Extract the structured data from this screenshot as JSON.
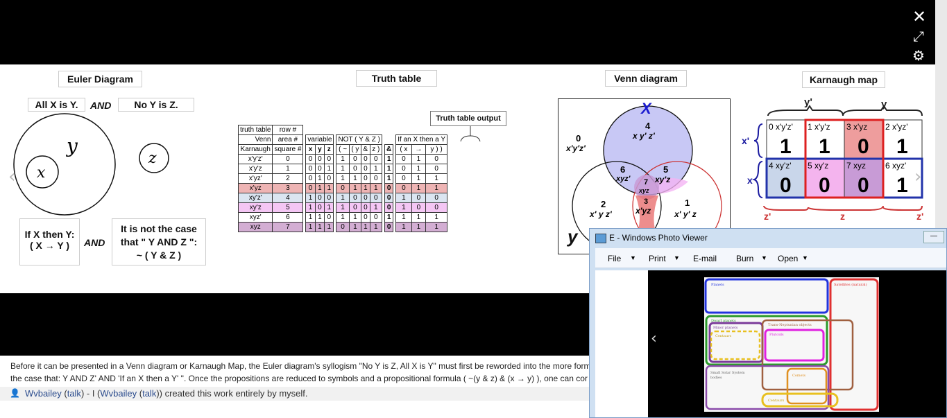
{
  "viewer": {
    "close_icon": "close-icon",
    "expand_icon": "expand-icon",
    "settings_icon": "gear-icon",
    "prev_glyph": "‹",
    "next_glyph": "›"
  },
  "figure": {
    "euler": {
      "title": "Euler Diagram",
      "premise1": "All X is Y.",
      "and": "AND",
      "premise2": "No Y is Z.",
      "y_label": "y",
      "x_label": "x",
      "z_label": "z",
      "ifthen_line1": "If X then Y:",
      "ifthen_line2": "( X → Y )",
      "and2": "AND",
      "notcase_line1": "It is not the case",
      "notcase_line2": "that \" Y AND Z \":",
      "notcase_line3": "~ ( Y & Z )"
    },
    "truth": {
      "title": "Truth table",
      "output_label": "Truth table output",
      "hdr_truthtable": "truth table",
      "hdr_row": "row #",
      "hdr_venn": "Venn",
      "hdr_area": "area #",
      "hdr_karnaugh": "Karnaugh",
      "hdr_square": "square #",
      "hdr_variable": "variable",
      "hdr_not": "NOT ( Y & Z )",
      "hdr_ifthen": "If an X then a Y",
      "cols": [
        "x",
        "y",
        "z",
        "( ~",
        "( y",
        "&",
        "z )",
        "&",
        "( x",
        "→",
        "y ) )"
      ],
      "rows": [
        {
          "term": "x'y'z'",
          "n": "0",
          "v": [
            "0",
            "0",
            "0"
          ],
          "o": [
            "1",
            "0",
            "0",
            "0",
            "1",
            "0",
            "1",
            "0"
          ],
          "bg": "#ffffff"
        },
        {
          "term": "x'y'z",
          "n": "1",
          "v": [
            "0",
            "0",
            "1"
          ],
          "o": [
            "1",
            "0",
            "0",
            "1",
            "1",
            "0",
            "1",
            "0"
          ],
          "bg": "#ffffff"
        },
        {
          "term": "x'yz'",
          "n": "2",
          "v": [
            "0",
            "1",
            "0"
          ],
          "o": [
            "1",
            "1",
            "0",
            "0",
            "1",
            "0",
            "1",
            "1"
          ],
          "bg": "#ffffff"
        },
        {
          "term": "x'yz",
          "n": "3",
          "v": [
            "0",
            "1",
            "1"
          ],
          "o": [
            "0",
            "1",
            "1",
            "1",
            "0",
            "0",
            "1",
            "1"
          ],
          "bg": "#eeb4b4"
        },
        {
          "term": "xy'z'",
          "n": "4",
          "v": [
            "1",
            "0",
            "0"
          ],
          "o": [
            "1",
            "0",
            "0",
            "0",
            "0",
            "1",
            "0",
            "0"
          ],
          "bg": "#dbe5f1"
        },
        {
          "term": "xy'z",
          "n": "5",
          "v": [
            "1",
            "0",
            "1"
          ],
          "o": [
            "1",
            "0",
            "0",
            "1",
            "0",
            "1",
            "0",
            "0"
          ],
          "bg": "#f4c6f4"
        },
        {
          "term": "xyz'",
          "n": "6",
          "v": [
            "1",
            "1",
            "0"
          ],
          "o": [
            "1",
            "1",
            "0",
            "0",
            "1",
            "1",
            "1",
            "1"
          ],
          "bg": "#ffffff"
        },
        {
          "term": "xyz",
          "n": "7",
          "v": [
            "1",
            "1",
            "1"
          ],
          "o": [
            "0",
            "1",
            "1",
            "1",
            "0",
            "1",
            "1",
            "1"
          ],
          "bg": "#d3aed3"
        }
      ]
    },
    "venn": {
      "title": "Venn diagram",
      "x": "X",
      "y": "y",
      "a0n": "0",
      "a0": "x'y'z'",
      "a4n": "4",
      "a4": "x y' z'",
      "a6n": "6",
      "a6": "xyz'",
      "a5n": "5",
      "a5": "xy'z",
      "a7n": "7",
      "a7": "xyz",
      "a2n": "2",
      "a2": "x' y z'",
      "a3n": "3",
      "a3": "x'yz",
      "a1n": "1",
      "a1": "x' y' z"
    },
    "kmap": {
      "title": "Karnaugh map",
      "yp": "y'",
      "y": "y",
      "xp": "x'",
      "x": "x",
      "zp1": "z'",
      "z": "z",
      "zp2": "z'",
      "cells": [
        {
          "n": "0",
          "t": "x'y'z'",
          "v": "1",
          "bg": "#ffffff"
        },
        {
          "n": "1",
          "t": "x'y'z",
          "v": "1",
          "bg": "#ffffff"
        },
        {
          "n": "3",
          "t": "x'yz",
          "v": "0",
          "bg": "#ee9d9d"
        },
        {
          "n": "2",
          "t": "x'yz'",
          "v": "1",
          "bg": "#ffffff"
        },
        {
          "n": "4",
          "t": "xy'z'",
          "v": "0",
          "bg": "#c9d6ea"
        },
        {
          "n": "5",
          "t": "xy'z",
          "v": "0",
          "bg": "#f4b4ee"
        },
        {
          "n": "7",
          "t": "xyz",
          "v": "0",
          "bg": "#c89bd6"
        },
        {
          "n": "6",
          "t": "xyz'",
          "v": "1",
          "bg": "#ffffff"
        }
      ]
    }
  },
  "caption": {
    "line1": "Before it can be presented in a Venn diagram or Karnaugh Map, the Euler diagram's syllogism \"No Y is Z, All X is Y\" must first be reworded into the more form",
    "line2": "the case that: Y AND Z' AND 'If an X then a Y' \". Once the propositions are reduced to symbols and a propositional formula ( ~(y & z) & (x → y) ), one can cor",
    "author": "Wvbailey",
    "talk1": "talk",
    "mid": " - I (",
    "author2": "Wvbailey",
    "talk2": "talk",
    "tail": ")) created this work entirely by myself."
  },
  "photo_viewer": {
    "title": "E - Windows Photo Viewer",
    "menu": [
      "File",
      "Print",
      "E-mail",
      "Burn",
      "Open"
    ],
    "img": {
      "planets": "Planets",
      "satellites": "Satellites (natural)",
      "dwarf": "Dwarf planets",
      "minor": "Minor planets",
      "tno": "Trans-Neptunian objects",
      "centaurs": "Centaurs",
      "plutoids": "Plutoids",
      "sss1": "Small Solar System",
      "sss2": "bodies",
      "comets": "Comets",
      "centaurs2": "Centaurs"
    }
  }
}
